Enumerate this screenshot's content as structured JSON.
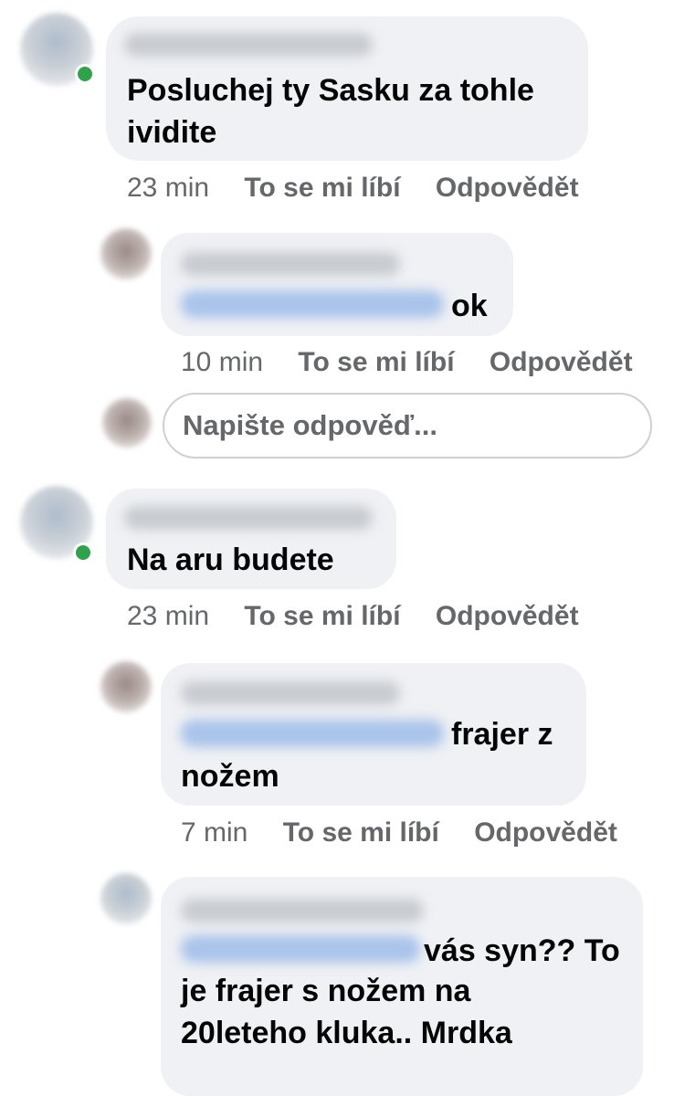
{
  "colors": {
    "bubble": "#eff1f4",
    "text": "#050505",
    "secondary": "#65676b",
    "online": "#31a24c",
    "mention_blur": "#a9c3ea"
  },
  "comments": [
    {
      "text_lines": [
        "Posluchej ty Sasku za tohle",
        "ividite"
      ],
      "time": "23 min",
      "like": "To se mi líbí",
      "reply": "Odpovědět"
    },
    {
      "text_after_mention": "ok",
      "time": "10 min",
      "like": "To se mi líbí",
      "reply": "Odpovědět"
    },
    {
      "text_lines": [
        "Na aru budete"
      ],
      "time": "23 min",
      "like": "To se mi líbí",
      "reply": "Odpovědět"
    },
    {
      "text_after_mention": "frajer z",
      "text_line2": "nožem",
      "time": "7 min",
      "like": "To se mi líbí",
      "reply": "Odpovědět"
    },
    {
      "text_after_mention": "vás syn?? To",
      "text_line2": "je frajer s nožem na",
      "text_line3": "20leteho kluka.. Mrdka"
    }
  ],
  "reply_box": {
    "placeholder": "Napište odpověď..."
  }
}
